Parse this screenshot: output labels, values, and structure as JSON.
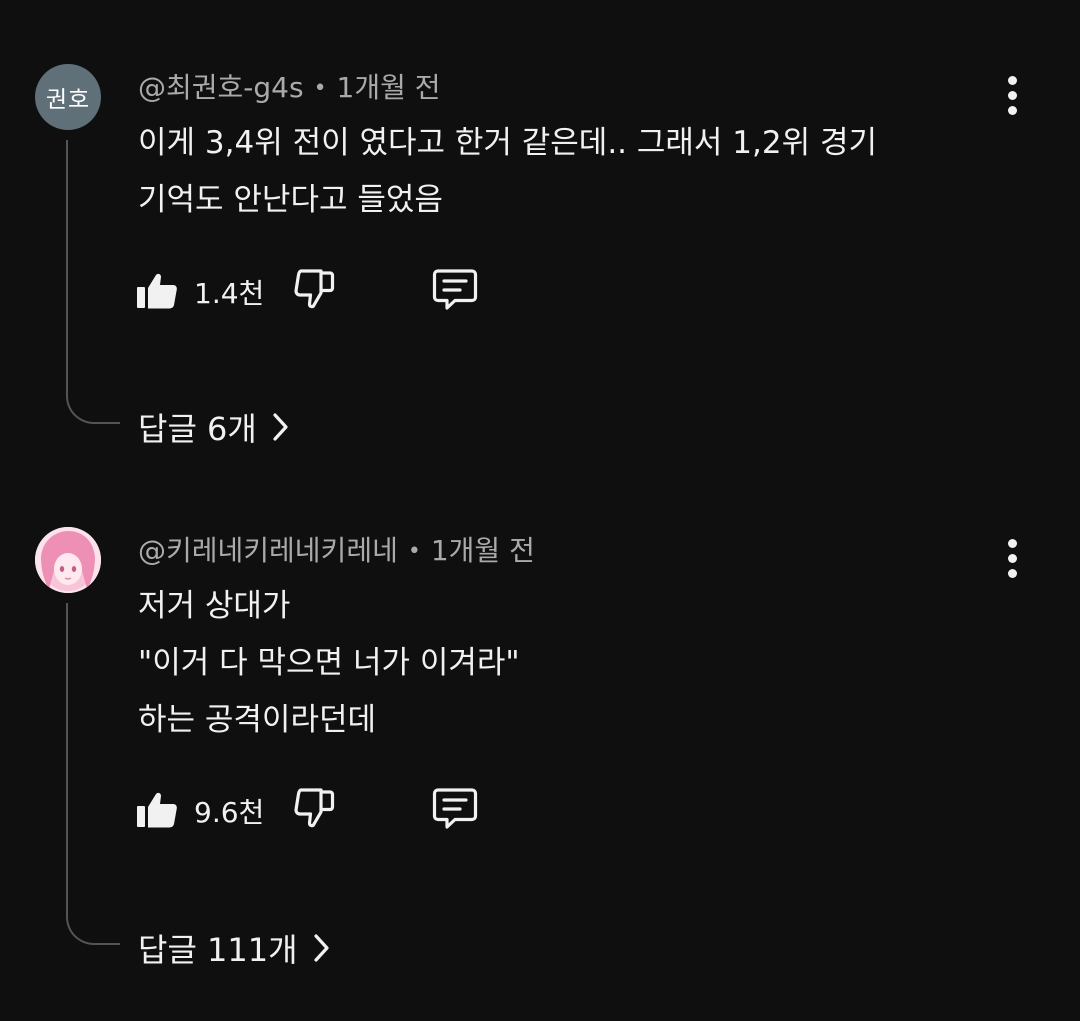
{
  "comments": [
    {
      "avatar_text": "권호",
      "author": "@최권호-g4s",
      "time": "1개월 전",
      "lines": [
        "이게 3,4위 전이 였다고 한거 같은데.. 그래서 1,2위  경기",
        "기억도 안난다고 들었음"
      ],
      "likes": "1.4천",
      "replies_label": "답글 6개"
    },
    {
      "avatar_text": "",
      "author": "@키레네키레네키레네",
      "time": "1개월 전",
      "lines": [
        "저거 상대가",
        "\"이거 다 막으면 너가 이겨라\"",
        "하는 공격이라던데"
      ],
      "likes": "9.6천",
      "replies_label": "답글 111개"
    }
  ],
  "meta_separator": "•",
  "icons": {
    "like": "thumbs-up-icon",
    "dislike": "thumbs-down-icon",
    "reply": "comment-bubble-icon",
    "more": "more-vertical-icon",
    "chevron": "chevron-right-icon"
  },
  "colors": {
    "background": "#0f0f0f",
    "text": "#f1f1f1",
    "meta": "#aaaaaa",
    "thread_line": "#545454",
    "avatar_bg": "#5f7079"
  }
}
